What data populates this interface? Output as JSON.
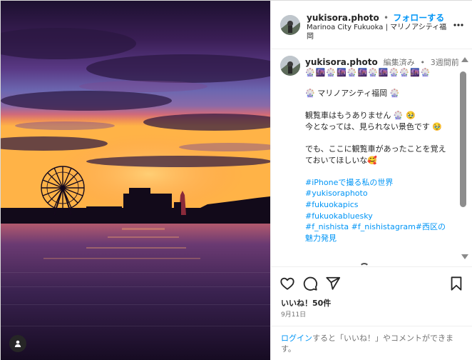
{
  "header": {
    "username": "yukisora.photo",
    "separator": "•",
    "follow_label": "フォローする",
    "location": "Marinoa City Fukuoka | マリノアシティ福岡"
  },
  "caption": {
    "username": "yukisora.photo",
    "edited": "編集済み",
    "separator": "•",
    "time_ago": "3週間前",
    "emoji_row": "🎡🌆🎡🌆🎡🌆🎡🌆🎡🎡🌆🎡",
    "lines": [
      "🎡 マリノアシティ福岡 🎡",
      "",
      "観覧車はもうありません 🎡 🥹",
      "今となっては、見られない景色です 🥹",
      "",
      "でも、ここに観覧車があったことを覚えておいてほしいな🥰"
    ],
    "hashtags": [
      "#iPhoneで撮る私の世界",
      "#yukisoraphoto",
      "#fukuokapics",
      "#fukuokabluesky"
    ],
    "hashtag_last_line": {
      "part1": "#f_nishista",
      "part2": "#f_nishistagram",
      "part3": "#西区の魅力発見"
    }
  },
  "actions": {
    "icons": [
      "heart-icon",
      "comment-icon",
      "share-icon",
      "bookmark-icon"
    ],
    "likes": "いいね！50件",
    "date": "9月11日"
  },
  "login_prompt": {
    "link": "ログイン",
    "rest": "すると「いいね！」やコメントができます。"
  },
  "colors": {
    "link_blue": "#0095f6",
    "hashtag": "#00376b",
    "muted": "#737373"
  }
}
